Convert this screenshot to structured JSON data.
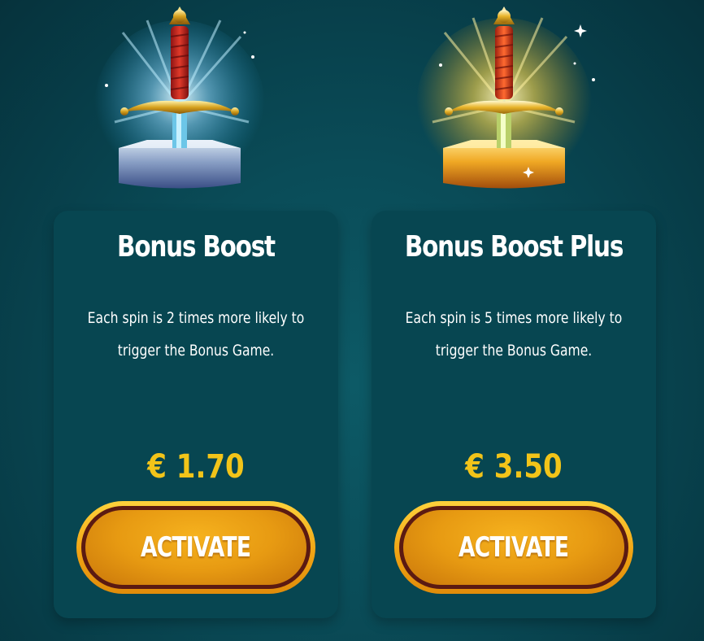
{
  "offers": [
    {
      "title": "Bonus Boost",
      "description": "Each spin is 2 times more likely to trigger the Bonus Game.",
      "price": "€ 1.70",
      "button_label": "ACTIVATE",
      "icon": "sword-in-stone-blue-glow-icon",
      "glow_color": "#8fd8ff"
    },
    {
      "title": "Bonus Boost Plus",
      "description": "Each spin is 5 times more likely to trigger the Bonus Game.",
      "price": "€ 3.50",
      "button_label": "ACTIVATE",
      "icon": "sword-in-stone-gold-glow-icon",
      "glow_color": "#ffd84a"
    }
  ],
  "colors": {
    "background": "#0a4c58",
    "card": "#074651",
    "price": "#f2c419",
    "button": "#f0a414",
    "button_ring": "#5b1a12"
  }
}
